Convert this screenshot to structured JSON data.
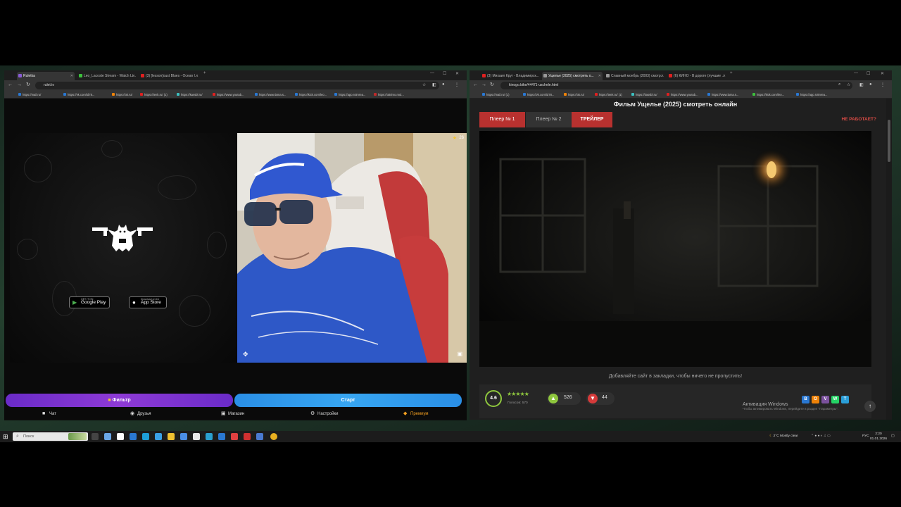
{
  "left_window": {
    "tabs": [
      {
        "label": "Ruletka",
        "color": "#8a5cd6"
      },
      {
        "label": "Leo_Lacoste Stream - Watch Li...",
        "color": "#3cbf3c"
      },
      {
        "label": "(3) [lesson]oust Blues - Ocean l...",
        "color": "#e02020"
      }
    ],
    "url": "rulet.tv",
    "bookmarks": [
      "https://mail.ru/",
      "https://vk.com/id78...",
      "https://ok.ru/",
      "https://tenk.ru/ (1)",
      "https://kassbl.ru/",
      "https://www.youtub...",
      "https://www.lama.s...",
      "https://kick.com/leo...",
      "https://app.roimrea...",
      "https://ottrimo.mul..."
    ],
    "google_play": {
      "small": "GET IT ON",
      "label": "Google Play"
    },
    "app_store": {
      "small": "Download on the",
      "label": "App Store"
    },
    "webcam_badge": "26",
    "filter_button": "Фильтр",
    "start_button": "Старт",
    "nav": [
      {
        "label": "Чат",
        "icon": "chat-icon"
      },
      {
        "label": "Друзья",
        "icon": "friends-icon"
      },
      {
        "label": "Магазин",
        "icon": "shop-icon"
      },
      {
        "label": "Настройки",
        "icon": "settings-icon"
      },
      {
        "label": "Премиум",
        "icon": "premium-icon"
      }
    ]
  },
  "right_window": {
    "tabs": [
      {
        "label": "(3) Михаил Круг - Владимирск...",
        "color": "#e02020"
      },
      {
        "label": "Ущелье (2025) смотреть о...",
        "color": "#999999"
      },
      {
        "label": "Славный монбрь (2003) смотр...",
        "color": "#999999"
      },
      {
        "label": "(6) КИНО - В дороге (лучшие ...",
        "color": "#e02020"
      }
    ],
    "url": "kinogo.bike/44471-uschele.html",
    "bookmarks": [
      "https://mail.ru/ (1)",
      "https://vk.com/id78...",
      "https://ok.ru/",
      "https://tenk.ru/ (1)",
      "https://kassbl.ru/",
      "https://www.youtub...",
      "https://www.lama.s...",
      "https://kick.com/leo...",
      "https://app.roimrea..."
    ],
    "page_title": "Фильм Ущелье (2025) смотреть онлайн",
    "player_tabs": [
      "Плеер № 1",
      "Плеер № 2",
      "ТРЕЙЛЕР"
    ],
    "not_working": "НЕ РАБОТАЕТ?",
    "bookmark_hint": "Добавляйте сайт в закладки, чтобы ничего не пропустить!",
    "rating": {
      "score": "4.6",
      "votes": "Голосов: 570",
      "likes": "526",
      "dislikes": "44"
    },
    "share": [
      {
        "label": "В",
        "color": "#2a78d2"
      },
      {
        "label": "О",
        "color": "#ee8208"
      },
      {
        "label": "V",
        "color": "#7b519d"
      },
      {
        "label": "W",
        "color": "#25d366"
      },
      {
        "label": "T",
        "color": "#2a9ed8"
      }
    ],
    "activation_title": "Активация Windows",
    "activation_text": "Чтобы активировать Windows, перейдите в раздел \"Параметры\"."
  },
  "taskbar": {
    "search_placeholder": "Поиск",
    "weather": "2°C  Mostly clear",
    "lang": "РУС",
    "time": "2:20",
    "date": "01.01.2026"
  }
}
